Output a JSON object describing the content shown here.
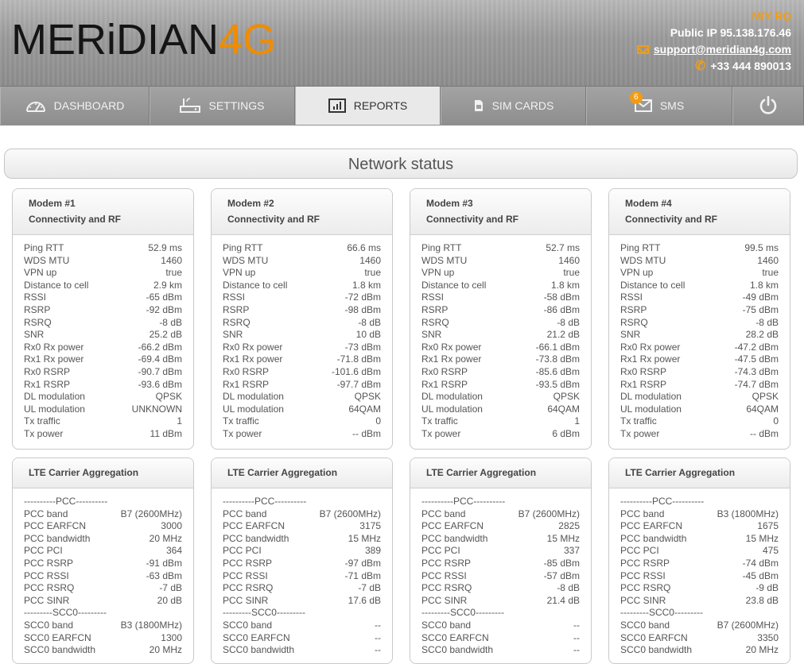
{
  "brand": {
    "logo_part1": "MERiDIAN",
    "logo_part2": "4G",
    "accent": "#f08c00"
  },
  "contact": {
    "vessel": "M/Y RQ",
    "public_ip": "Public IP 95.138.176.46",
    "email": "support@meridian4g.com",
    "phone": "+33 444 890013",
    "icons": [
      "mail-icon",
      "phone-icon"
    ]
  },
  "nav": {
    "tabs": [
      {
        "label": "DASHBOARD",
        "icon": "dashboard-gauge-icon",
        "active": false
      },
      {
        "label": "SETTINGS",
        "icon": "router-settings-icon",
        "active": false
      },
      {
        "label": "REPORTS",
        "icon": "reports-chart-icon",
        "active": true
      },
      {
        "label": "SIM CARDS",
        "icon": "sim-card-icon",
        "active": false
      },
      {
        "label": "SMS",
        "icon": "envelope-icon",
        "active": false,
        "badge": "6"
      }
    ],
    "power_icon": "power-icon"
  },
  "page": {
    "title": "Network status"
  },
  "connectivity_labels": [
    "Ping RTT",
    "WDS MTU",
    "VPN up",
    "Distance to cell",
    "RSSI",
    "RSRP",
    "RSRQ",
    "SNR",
    "Rx0 Rx power",
    "Rx1 Rx power",
    "Rx0 RSRP",
    "Rx1 RSRP",
    "DL modulation",
    "UL modulation",
    "Tx traffic",
    "Tx power"
  ],
  "modems": [
    {
      "title": "Modem #1",
      "subtitle": "Connectivity and RF",
      "values": [
        "52.9 ms",
        "1460",
        "true",
        "2.9 km",
        "-65 dBm",
        "-92 dBm",
        "-8 dB",
        "25.2 dB",
        "-66.2 dBm",
        "-69.4 dBm",
        "-90.7 dBm",
        "-93.6 dBm",
        "QPSK",
        "UNKNOWN",
        "1",
        "11 dBm"
      ]
    },
    {
      "title": "Modem #2",
      "subtitle": "Connectivity and RF",
      "values": [
        "66.6 ms",
        "1460",
        "true",
        "1.8 km",
        "-72 dBm",
        "-98 dBm",
        "-8 dB",
        "10 dB",
        "-73 dBm",
        "-71.8 dBm",
        "-101.6 dBm",
        "-97.7 dBm",
        "QPSK",
        "64QAM",
        "0",
        "-- dBm"
      ]
    },
    {
      "title": "Modem #3",
      "subtitle": "Connectivity and RF",
      "values": [
        "52.7 ms",
        "1460",
        "true",
        "1.8 km",
        "-58 dBm",
        "-86 dBm",
        "-8 dB",
        "21.2 dB",
        "-66.1 dBm",
        "-73.8 dBm",
        "-85.6 dBm",
        "-93.5 dBm",
        "QPSK",
        "64QAM",
        "1",
        "6 dBm"
      ]
    },
    {
      "title": "Modem #4",
      "subtitle": "Connectivity and RF",
      "values": [
        "99.5 ms",
        "1460",
        "true",
        "1.8 km",
        "-49 dBm",
        "-75 dBm",
        "-8 dB",
        "28.2 dB",
        "-47.2 dBm",
        "-47.5 dBm",
        "-74.3 dBm",
        "-74.7 dBm",
        "QPSK",
        "64QAM",
        "0",
        "-- dBm"
      ]
    }
  ],
  "lte": {
    "title": "LTE Carrier Aggregation",
    "pcc_separator": "----------PCC----------",
    "scc0_separator": "---------SCC0---------",
    "pcc_labels": [
      "PCC band",
      "PCC EARFCN",
      "PCC bandwidth",
      "PCC PCI",
      "PCC RSRP",
      "PCC RSSI",
      "PCC RSRQ",
      "PCC SINR"
    ],
    "scc0_labels": [
      "SCC0 band",
      "SCC0 EARFCN",
      "SCC0 bandwidth"
    ],
    "modems": [
      {
        "pcc": [
          "B7 (2600MHz)",
          "3000",
          "20 MHz",
          "364",
          "-91 dBm",
          "-63 dBm",
          "-7 dB",
          "20 dB"
        ],
        "scc0": [
          "B3 (1800MHz)",
          "1300",
          "20 MHz"
        ]
      },
      {
        "pcc": [
          "B7 (2600MHz)",
          "3175",
          "15 MHz",
          "389",
          "-97 dBm",
          "-71 dBm",
          "-7 dB",
          "17.6 dB"
        ],
        "scc0": [
          "--",
          "--",
          "--"
        ]
      },
      {
        "pcc": [
          "B7 (2600MHz)",
          "2825",
          "15 MHz",
          "337",
          "-85 dBm",
          "-57 dBm",
          "-8 dB",
          "21.4 dB"
        ],
        "scc0": [
          "--",
          "--",
          "--"
        ]
      },
      {
        "pcc": [
          "B3 (1800MHz)",
          "1675",
          "15 MHz",
          "475",
          "-74 dBm",
          "-45 dBm",
          "-9 dB",
          "23.8 dB"
        ],
        "scc0": [
          "B7 (2600MHz)",
          "3350",
          "20 MHz"
        ]
      }
    ]
  }
}
